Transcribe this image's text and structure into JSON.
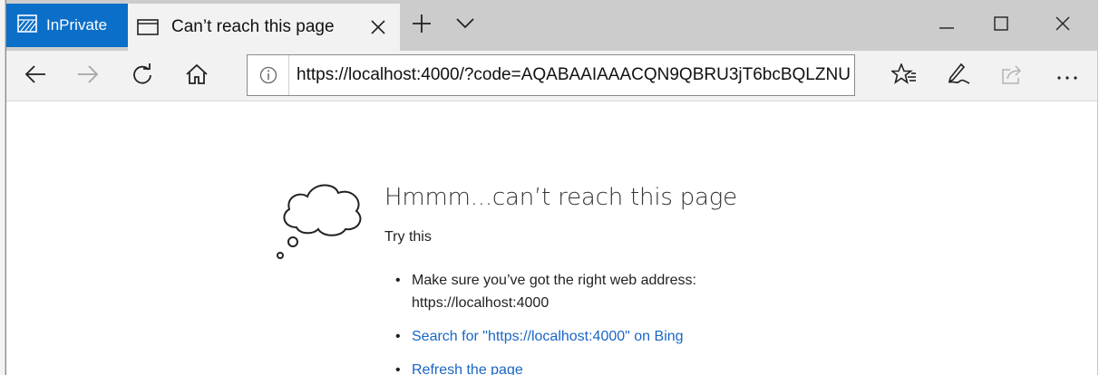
{
  "tabs": {
    "inprivate_label": "InPrivate",
    "active_tab_title": "Can’t reach this page"
  },
  "address_bar": {
    "url": "https://localhost:4000/?code=AQABAAIAAACQN9QBRU3jT6bcBQLZNU"
  },
  "error_page": {
    "title": "Hmmm...can’t reach this page",
    "try_this": "Try this",
    "suggestion_1": "Make sure you’ve got the right web address: https://localhost:4000",
    "suggestion_2": "Search for \"https://localhost:4000\" on Bing",
    "suggestion_3": "Refresh the page"
  },
  "colors": {
    "inprivate_bg": "#0b6fc9",
    "titlebar_bg": "#cccccc",
    "link": "#1a66c4"
  },
  "icons": {
    "inprivate": "inprivate-icon",
    "tab": "tab-page-icon",
    "close_tab": "close-icon",
    "new_tab": "plus-icon",
    "tab_list": "chevron-down-icon",
    "minimize": "minimize-icon",
    "maximize": "maximize-icon",
    "close_window": "close-window-icon",
    "back": "back-arrow-icon",
    "forward": "forward-arrow-icon",
    "refresh": "refresh-icon",
    "home": "home-icon",
    "info": "info-icon",
    "favorites": "star-list-icon",
    "notes": "pen-icon",
    "share": "share-icon",
    "more": "more-icon",
    "cloud": "thought-cloud-icon"
  }
}
